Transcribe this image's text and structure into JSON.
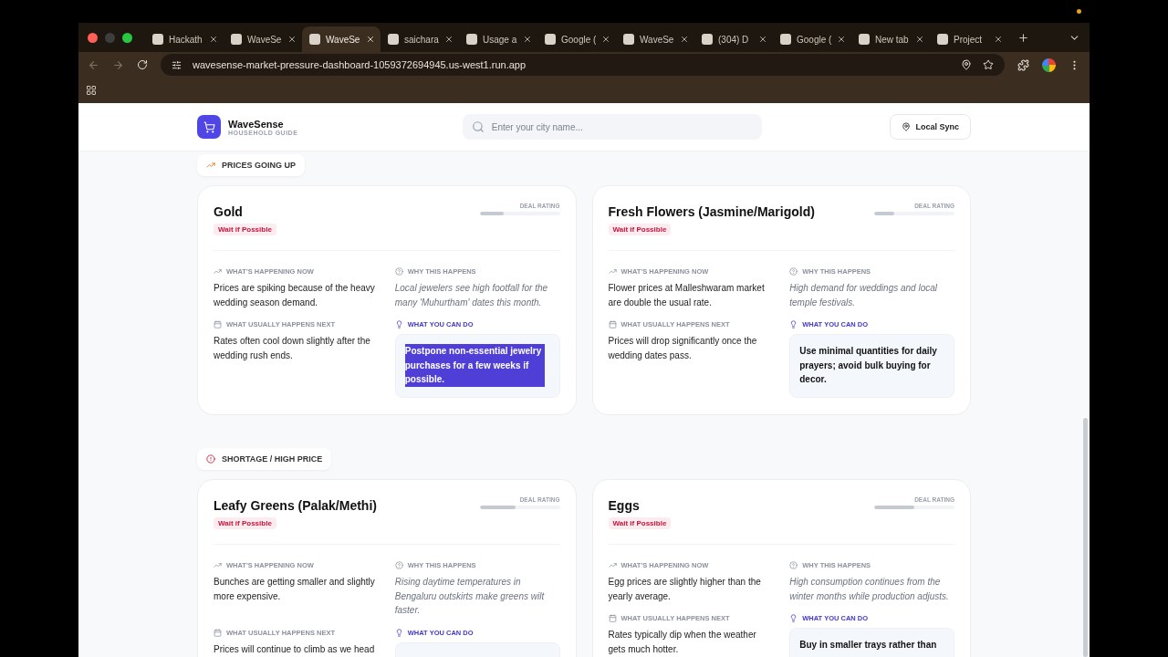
{
  "browser": {
    "tabs": [
      {
        "title": "Hackath",
        "selected": false
      },
      {
        "title": "WaveSe",
        "selected": false
      },
      {
        "title": "WaveSe",
        "selected": true
      },
      {
        "title": "saichara",
        "selected": false
      },
      {
        "title": "Usage a",
        "selected": false
      },
      {
        "title": "Google (",
        "selected": false
      },
      {
        "title": "WaveSe",
        "selected": false
      },
      {
        "title": "(304) D",
        "selected": false
      },
      {
        "title": "Google (",
        "selected": false
      },
      {
        "title": "New tab",
        "selected": false
      },
      {
        "title": "Project",
        "selected": false
      }
    ],
    "url": "wavesense-market-pressure-dashboard-1059372694945.us-west1.run.app"
  },
  "header": {
    "brand": "WaveSense",
    "tagline": "HOUSEHOLD GUIDE",
    "search": {
      "placeholder": "Enter your city name..."
    },
    "sync_button": "Local Sync"
  },
  "sections": [
    {
      "label": "PRICES GOING UP",
      "kind": "rising",
      "cards": [
        {
          "name": "Gold",
          "badge": "Wait if Possible",
          "rating_label": "DEAL RATING",
          "level": 0.3,
          "now_label": "WHAT'S HAPPENING NOW",
          "now": "Prices are spiking because of the heavy wedding season demand.",
          "why_label": "WHY THIS HAPPENS",
          "why": "Local jewelers see high footfall for the many 'Muhurtham' dates this month.",
          "next_label": "WHAT USUALLY HAPPENS NEXT",
          "next": "Rates often cool down slightly after the wedding rush ends.",
          "tip_label": "WHAT YOU CAN DO",
          "tip": "Postpone non-essential jewelry purchases for a few weeks if possible.",
          "tip_selected": true
        },
        {
          "name": "Fresh Flowers (Jasmine/Marigold)",
          "badge": "Wait if Possible",
          "rating_label": "DEAL RATING",
          "level": 0.25,
          "now_label": "WHAT'S HAPPENING NOW",
          "now": "Flower prices at Malleshwaram market are double the usual rate.",
          "why_label": "WHY THIS HAPPENS",
          "why": "High demand for weddings and local temple festivals.",
          "next_label": "WHAT USUALLY HAPPENS NEXT",
          "next": "Prices will drop significantly once the wedding dates pass.",
          "tip_label": "WHAT YOU CAN DO",
          "tip": "Use minimal quantities for daily prayers; avoid bulk buying for decor.",
          "tip_selected": false
        }
      ]
    },
    {
      "label": "SHORTAGE / HIGH PRICE",
      "kind": "shortage",
      "cards": [
        {
          "name": "Leafy Greens (Palak/Methi)",
          "badge": "Wait if Possible",
          "rating_label": "DEAL RATING",
          "level": 0.45,
          "now_label": "WHAT'S HAPPENING NOW",
          "now": "Bunches are getting smaller and slightly more expensive.",
          "why_label": "WHY THIS HAPPENS",
          "why": "Rising daytime temperatures in Bengaluru outskirts make greens wilt faster.",
          "next_label": "WHAT USUALLY HAPPENS NEXT",
          "next": "Prices will continue to climb as we head",
          "tip_label": "WHAT YOU CAN DO"
        },
        {
          "name": "Eggs",
          "badge": "Wait if Possible",
          "rating_label": "DEAL RATING",
          "level": 0.5,
          "now_label": "WHAT'S HAPPENING NOW",
          "now": "Egg prices are slightly higher than the yearly average.",
          "why_label": "WHY THIS HAPPENS",
          "why": "High consumption continues from the winter months while production adjusts.",
          "next_label": "WHAT USUALLY HAPPENS NEXT",
          "next": "Rates typically dip when the weather gets much hotter.",
          "tip_label": "WHAT YOU CAN DO",
          "tip": "Buy in smaller trays rather than",
          "tip_selected": false
        }
      ]
    }
  ]
}
